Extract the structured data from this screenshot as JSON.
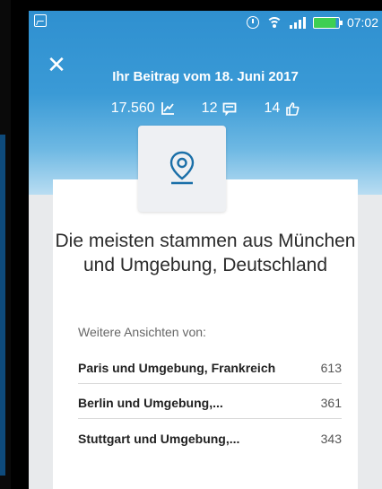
{
  "status_bar": {
    "time": "07:02",
    "icons": [
      "image-icon",
      "alarm-icon",
      "wifi-icon",
      "signal-icon",
      "battery-icon"
    ]
  },
  "header": {
    "close_label": "✕",
    "title": "Ihr Beitrag vom 18. Juni 2017",
    "stats": [
      {
        "value": "17.560",
        "icon": "views-chart-icon"
      },
      {
        "value": "12",
        "icon": "comment-icon"
      },
      {
        "value": "14",
        "icon": "like-icon"
      }
    ]
  },
  "card": {
    "icon": "location-pin-icon",
    "headline": "Die meisten stammen aus München und Umgebung, Deutschland",
    "subhead": "Weitere Ansichten von:",
    "rows": [
      {
        "label": "Paris und Umgebung, Frankreich",
        "count": "613"
      },
      {
        "label": "Berlin und Umgebung,...",
        "count": "361"
      },
      {
        "label": "Stuttgart und Umgebung,...",
        "count": "343"
      }
    ]
  },
  "colors": {
    "accent": "#2f90d0",
    "icon_blue": "#1a6fa8",
    "battery_green": "#3ecf52"
  }
}
